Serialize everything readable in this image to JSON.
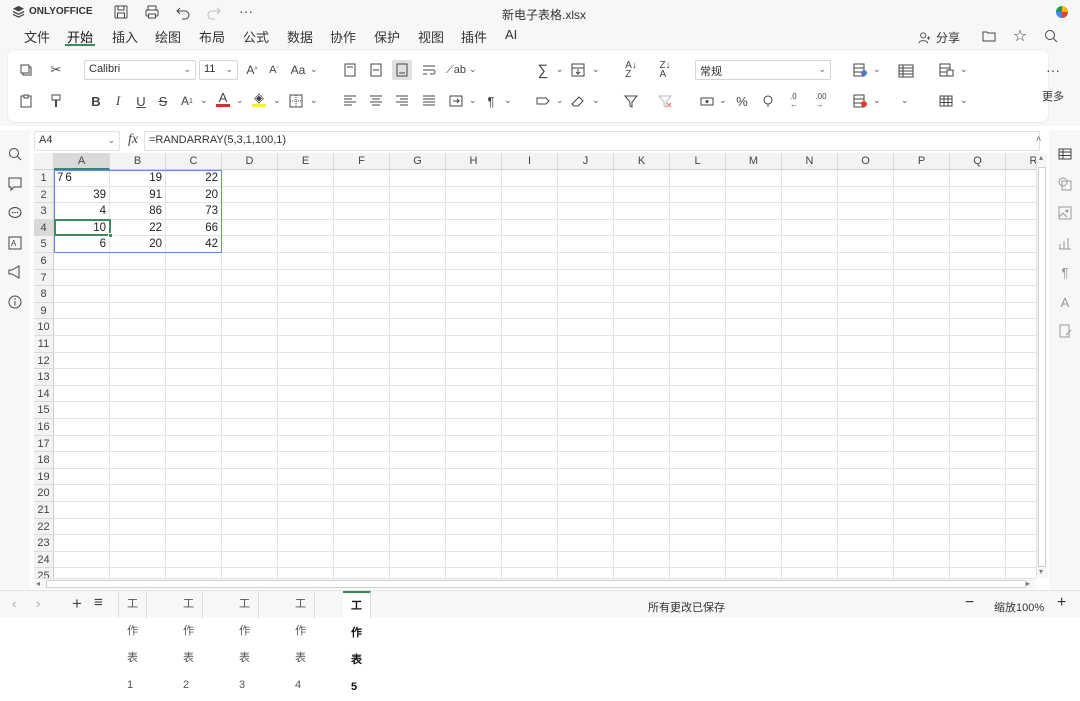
{
  "app": {
    "name": "ONLYOFFICE",
    "doc_title": "新电子表格.xlsx"
  },
  "menu": {
    "items": [
      "文件",
      "开始",
      "插入",
      "绘图",
      "布局",
      "公式",
      "数据",
      "协作",
      "保护",
      "视图",
      "插件",
      "AI"
    ],
    "active": "开始",
    "share": "分享"
  },
  "toolbar": {
    "font_name": "Calibri",
    "font_size": "11",
    "number_format": "常规",
    "more_label": "更多"
  },
  "formula_bar": {
    "cell_ref": "A4",
    "fx_label": "fx",
    "formula": "=RANDARRAY(5,3,1,100,1)"
  },
  "grid": {
    "columns": [
      "A",
      "B",
      "C",
      "D",
      "E",
      "F",
      "G",
      "H",
      "I",
      "J",
      "K",
      "L",
      "M",
      "N",
      "O",
      "P",
      "Q",
      "R"
    ],
    "rows": [
      "1",
      "2",
      "3",
      "4",
      "5",
      "6",
      "7",
      "8",
      "9",
      "10",
      "11",
      "12",
      "13",
      "14",
      "15",
      "16",
      "17",
      "18",
      "19",
      "20",
      "21",
      "22",
      "23",
      "24",
      "25"
    ],
    "data": [
      [
        "76",
        "19",
        "22"
      ],
      [
        "39",
        "91",
        "20"
      ],
      [
        "4",
        "86",
        "73"
      ],
      [
        "10",
        "22",
        "66"
      ],
      [
        "6",
        "20",
        "42"
      ]
    ],
    "active_cell": "A4"
  },
  "sheets": {
    "tabs": [
      "工作表1",
      "工作表2",
      "工作表3",
      "工作表4",
      "工作表5"
    ],
    "active": "工作表5"
  },
  "status": {
    "save_text": "所有更改已保存",
    "zoom": "缩放100%"
  },
  "colors": {
    "accent": "#3d8a5f",
    "active_underline": "#3d8a5f",
    "font_color": "#d32f2f",
    "highlight": "#ffeb3b"
  }
}
